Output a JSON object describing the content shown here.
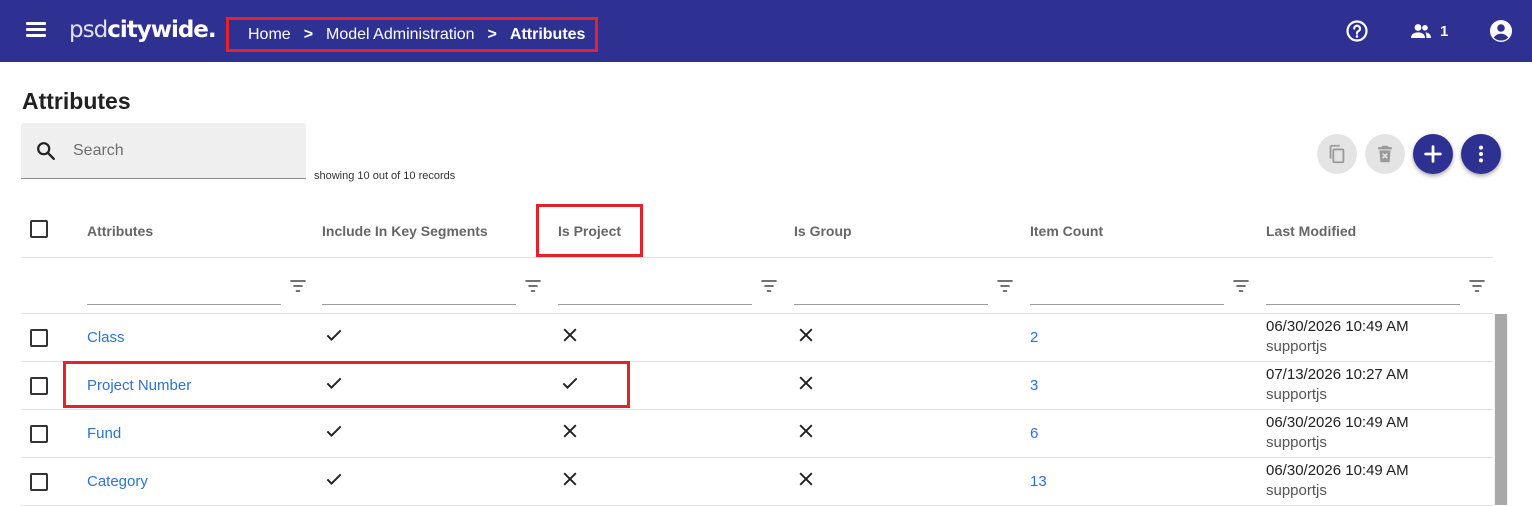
{
  "app": {
    "logo_light": "psd",
    "logo_bold": "citywide",
    "logo_mark": "."
  },
  "breadcrumb": {
    "items": [
      "Home",
      "Model Administration",
      "Attributes"
    ],
    "separator": ">"
  },
  "header": {
    "active_users": "1",
    "icons": [
      "menu-icon",
      "help-icon",
      "users-icon",
      "account-icon"
    ]
  },
  "page": {
    "title": "Attributes"
  },
  "search": {
    "placeholder": "Search",
    "value": ""
  },
  "records": {
    "summary": "showing 10 out of 10 records"
  },
  "toolbar": {
    "buttons": [
      "copy-icon",
      "delete-icon",
      "add-icon",
      "more-vert-icon"
    ]
  },
  "table": {
    "columns": [
      "Attributes",
      "Include In Key Segments",
      "Is Project",
      "Is Group",
      "Item Count",
      "Last Modified"
    ],
    "rows": [
      {
        "name": "Class",
        "key_segment": true,
        "is_project": false,
        "is_group": false,
        "item_count": "2",
        "modified_date": "06/30/2026 10:49 AM",
        "modified_by": "supportjs"
      },
      {
        "name": "Project Number",
        "key_segment": true,
        "is_project": true,
        "is_group": false,
        "item_count": "3",
        "modified_date": "07/13/2026 10:27 AM",
        "modified_by": "supportjs"
      },
      {
        "name": "Fund",
        "key_segment": true,
        "is_project": false,
        "is_group": false,
        "item_count": "6",
        "modified_date": "06/30/2026 10:49 AM",
        "modified_by": "supportjs"
      },
      {
        "name": "Category",
        "key_segment": true,
        "is_project": false,
        "is_group": false,
        "item_count": "13",
        "modified_date": "06/30/2026 10:49 AM",
        "modified_by": "supportjs"
      }
    ]
  },
  "colors": {
    "brand": "#2e3192",
    "link": "#2c73d2",
    "highlight": "#e5212b"
  }
}
